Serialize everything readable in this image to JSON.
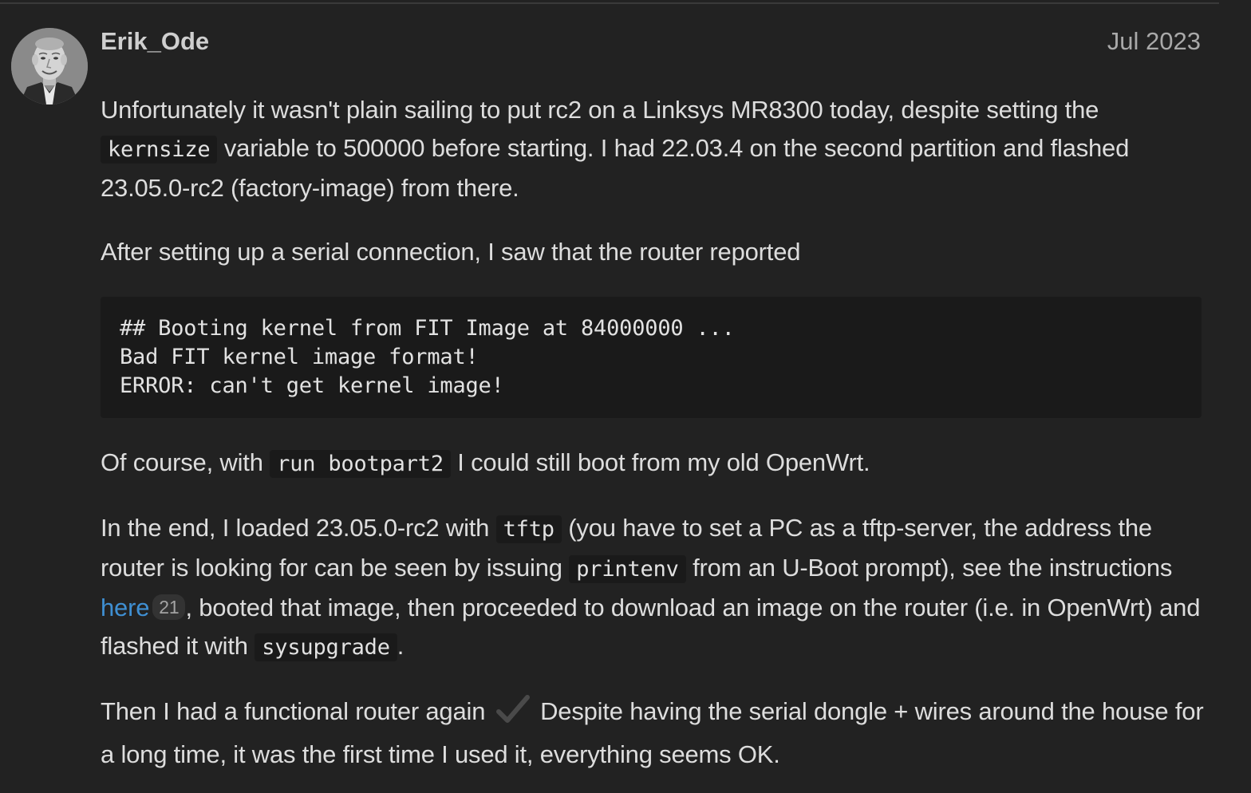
{
  "post": {
    "username": "Erik_Ode",
    "date": "Jul 2023",
    "p1": {
      "t1": "Unfortunately it wasn't plain sailing to put rc2 on a Linksys MR8300 today, despite setting the ",
      "code1": "kernsize",
      "t2": " variable to 500000 before starting. I had 22.03.4 on the second partition and flashed 23.05.0-rc2 (factory-image) from there."
    },
    "p2": "After setting up a serial connection, I saw that the router reported",
    "code_block": [
      "## Booting kernel from FIT Image at 84000000 ...",
      "Bad FIT kernel image format!",
      "ERROR: can't get kernel image!"
    ],
    "p3": {
      "t1": "Of course, with ",
      "code1": "run bootpart2",
      "t2": " I could still boot from my old OpenWrt."
    },
    "p4": {
      "t1": "In the end, I loaded 23.05.0-rc2 with ",
      "code1": "tftp",
      "t2": " (you have to set a PC as a tftp-server, the address the router is looking for can be seen by issuing ",
      "code2": "printenv",
      "t3": " from an U-Boot prompt), see the instructions ",
      "link_text": "here",
      "link_clicks": "21",
      "t4": ", booted that image, then proceeded to download an image on the router (i.e. in OpenWrt) and flashed it with ",
      "code3": "sysupgrade",
      "t5": "."
    },
    "p5": {
      "t1": "Then I had a functional router again ",
      "emoji": "check-mark-icon",
      "t2": " Despite having the serial dongle + wires around the house for a long time, it was the first time I used it, everything seems OK."
    }
  },
  "colors": {
    "background": "#222222",
    "text": "#dddddd",
    "link": "#3f8fd2",
    "code_bg": "#1a1a1a",
    "date": "#a9a9a9"
  }
}
